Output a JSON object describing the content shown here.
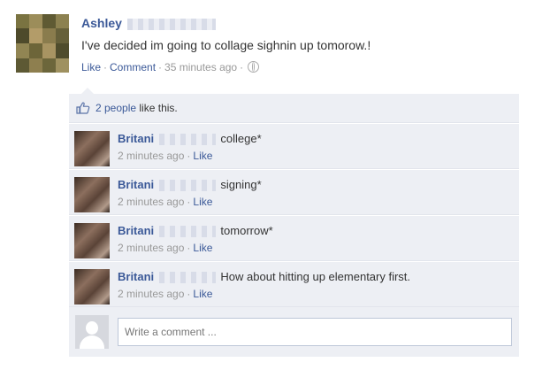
{
  "post": {
    "author": "Ashley",
    "text": "I've decided im going to collage sighnin up tomorow.!",
    "like_label": "Like",
    "comment_label": "Comment",
    "timestamp": "35 minutes ago"
  },
  "likes": {
    "count_link": "2 people",
    "suffix": "like this."
  },
  "comments": [
    {
      "author": "Britani",
      "text": "college*",
      "time": "2 minutes ago",
      "like_label": "Like"
    },
    {
      "author": "Britani",
      "text": "signing*",
      "time": "2 minutes ago",
      "like_label": "Like"
    },
    {
      "author": "Britani",
      "text": "tomorrow*",
      "time": "2 minutes ago",
      "like_label": "Like"
    },
    {
      "author": "Britani",
      "text": "How about hitting up elementary first.",
      "time": "2 minutes ago",
      "like_label": "Like"
    }
  ],
  "composer": {
    "placeholder": "Write a comment ..."
  },
  "colors": {
    "link": "#3b5998",
    "ufi_background": "#edeff4",
    "meta_text": "#999999"
  },
  "icons": {
    "post_avatar": "pixelated-profile-photo",
    "like": "thumbs-up-icon",
    "privacy": "globe-icon",
    "composer_avatar": "default-user-silhouette"
  }
}
